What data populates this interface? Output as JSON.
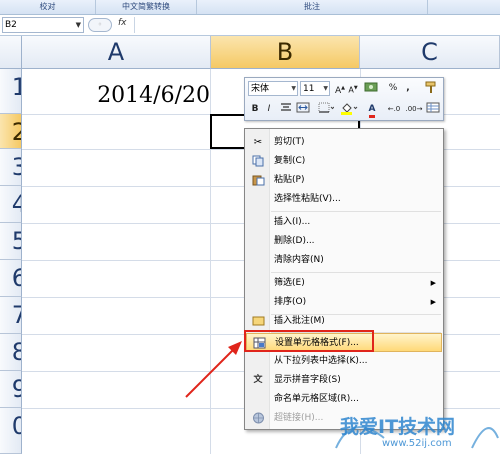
{
  "ribbon": {
    "groups": [
      "校对",
      "中文简繁转换",
      "批注"
    ]
  },
  "formula_bar": {
    "name_box": "B2",
    "fx": "fx"
  },
  "columns": [
    "A",
    "B",
    "C"
  ],
  "rows": [
    "1",
    "2",
    "3",
    "4",
    "5",
    "6",
    "7",
    "8",
    "9",
    "0"
  ],
  "cell_a1": "2014/6/20",
  "mini_toolbar": {
    "font": "宋体",
    "size": "11",
    "bold": "B",
    "italic": "I",
    "font_color_letter": "A",
    "percent": "%",
    "comma": ","
  },
  "context_menu": {
    "items": [
      {
        "label": "剪切(T)",
        "icon": "scissors-icon"
      },
      {
        "label": "复制(C)",
        "icon": "copy-icon"
      },
      {
        "label": "粘贴(P)",
        "icon": "paste-icon"
      },
      {
        "label": "选择性粘贴(V)..."
      },
      {
        "label": "插入(I)..."
      },
      {
        "label": "删除(D)..."
      },
      {
        "label": "清除内容(N)"
      },
      {
        "label": "筛选(E)",
        "submenu": true
      },
      {
        "label": "排序(O)",
        "submenu": true
      },
      {
        "label": "插入批注(M)",
        "icon": "comment-icon"
      },
      {
        "label": "设置单元格格式(F)...",
        "icon": "format-cells-icon",
        "highlighted": true
      },
      {
        "label": "从下拉列表中选择(K)..."
      },
      {
        "label": "显示拼音字段(S)",
        "icon": "phonetic-icon"
      },
      {
        "label": "命名单元格区域(R)..."
      },
      {
        "label": "超链接(H)...",
        "icon": "hyperlink-icon",
        "disabled": true
      }
    ]
  },
  "watermark": {
    "text": "我爱IT技术网",
    "url": "www.52ij.com"
  },
  "colors": {
    "highlight": "#ffd978",
    "annotation_red": "#e0251b",
    "header_selected": "#f5c964"
  }
}
